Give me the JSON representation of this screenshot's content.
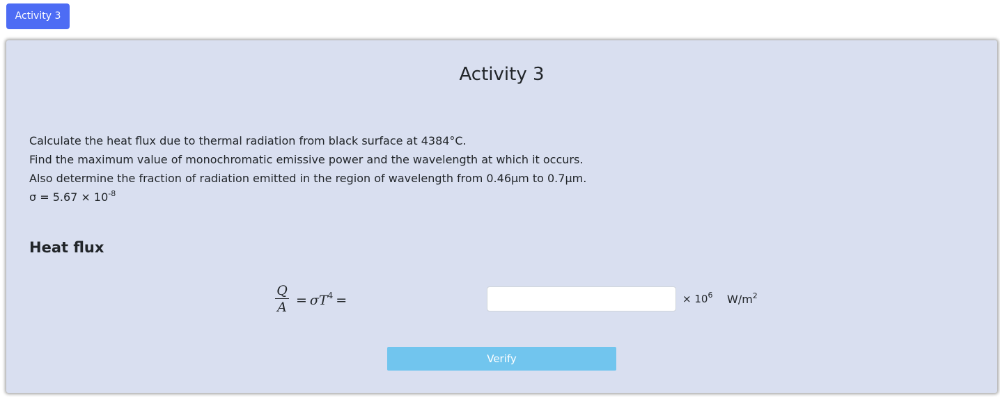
{
  "top_tab": {
    "label": "Activity 3"
  },
  "card": {
    "title": "Activity 3",
    "problem": {
      "line1": "Calculate the heat flux due to thermal radiation from black surface at 4384°C.",
      "line2": "Find the maximum value of monochromatic emissive power and the wavelength at which it occurs.",
      "line3": "Also determine the fraction of radiation emitted in the region of wavelength from 0.46μm to 0.7μm.",
      "sigma_prefix": "σ = 5.67 × 10",
      "sigma_exponent": "-8"
    },
    "section": {
      "heading": "Heat flux",
      "formula": {
        "numerator": "Q",
        "denominator": "A",
        "equals1": "=",
        "sigma": "σ",
        "variable": "T",
        "power": "4",
        "equals2": "="
      },
      "answer": {
        "value": "",
        "placeholder": ""
      },
      "multiplier_base": "× 10",
      "multiplier_exponent": "6",
      "unit_base": "W/m",
      "unit_exponent": "2"
    },
    "verify_label": "Verify"
  },
  "colors": {
    "tab_bg": "#4d6cf4",
    "card_bg": "#d9dff0",
    "verify_bg": "#71c5ee"
  }
}
